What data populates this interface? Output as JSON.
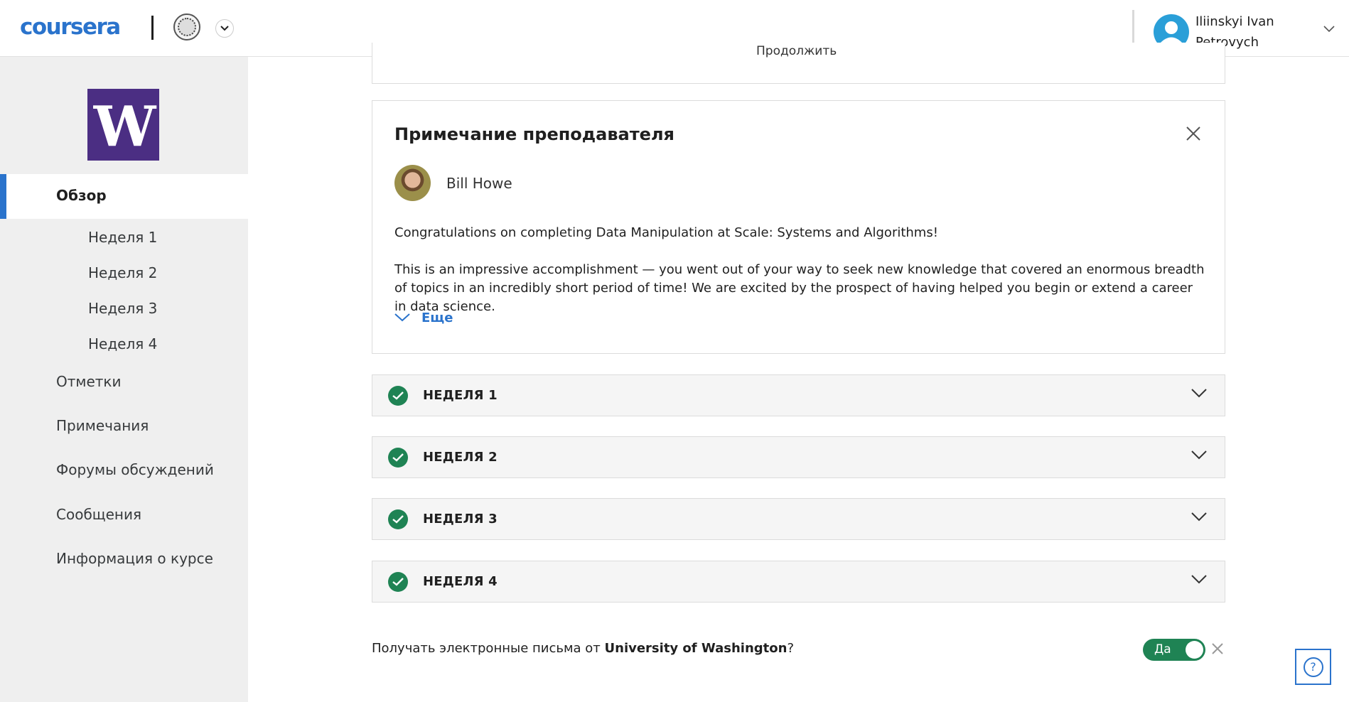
{
  "header": {
    "logo": "coursera",
    "user_name": "Iliinskyi Ivan Petrovych",
    "icons": {
      "partner_logo": "university-seal-icon",
      "partner_menu": "chevron-down-icon",
      "avatar": "user-avatar-icon",
      "user_menu": "chevron-down-icon"
    }
  },
  "sidebar": {
    "university_logo": "W",
    "overview": "Обзор",
    "weeks": [
      "Неделя 1",
      "Неделя 2",
      "Неделя 3",
      "Неделя 4"
    ],
    "items": [
      "Отметки",
      "Примечания",
      "Форумы обсуждений",
      "Сообщения",
      "Информация о курсе"
    ]
  },
  "main": {
    "clipped_text": "Продолжить",
    "instructor_note": {
      "title": "Примечание преподавателя",
      "instructor_name": "Bill Howe",
      "paragraph_1": "Congratulations on completing Data Manipulation at Scale: Systems and Algorithms!",
      "paragraph_2": "This is an impressive accomplishment — you went out of your way to seek new knowledge that covered an enormous breadth of topics in an incredibly short period of time! We are excited by the prospect of having helped you begin or extend a career in data science.",
      "more_label": "Еще"
    },
    "weeks": [
      "НЕДЕЛЯ 1",
      "НЕДЕЛЯ 2",
      "НЕДЕЛЯ 3",
      "НЕДЕЛЯ 4"
    ],
    "email_pref": {
      "prefix": "Получать электронные письма от ",
      "org": "University of Washington",
      "suffix": "?",
      "toggle_label": "Да"
    },
    "help": "?"
  },
  "colors": {
    "brand_blue": "#2a73cc",
    "uw_purple": "#4b2e83",
    "success_green": "#1f8354"
  }
}
